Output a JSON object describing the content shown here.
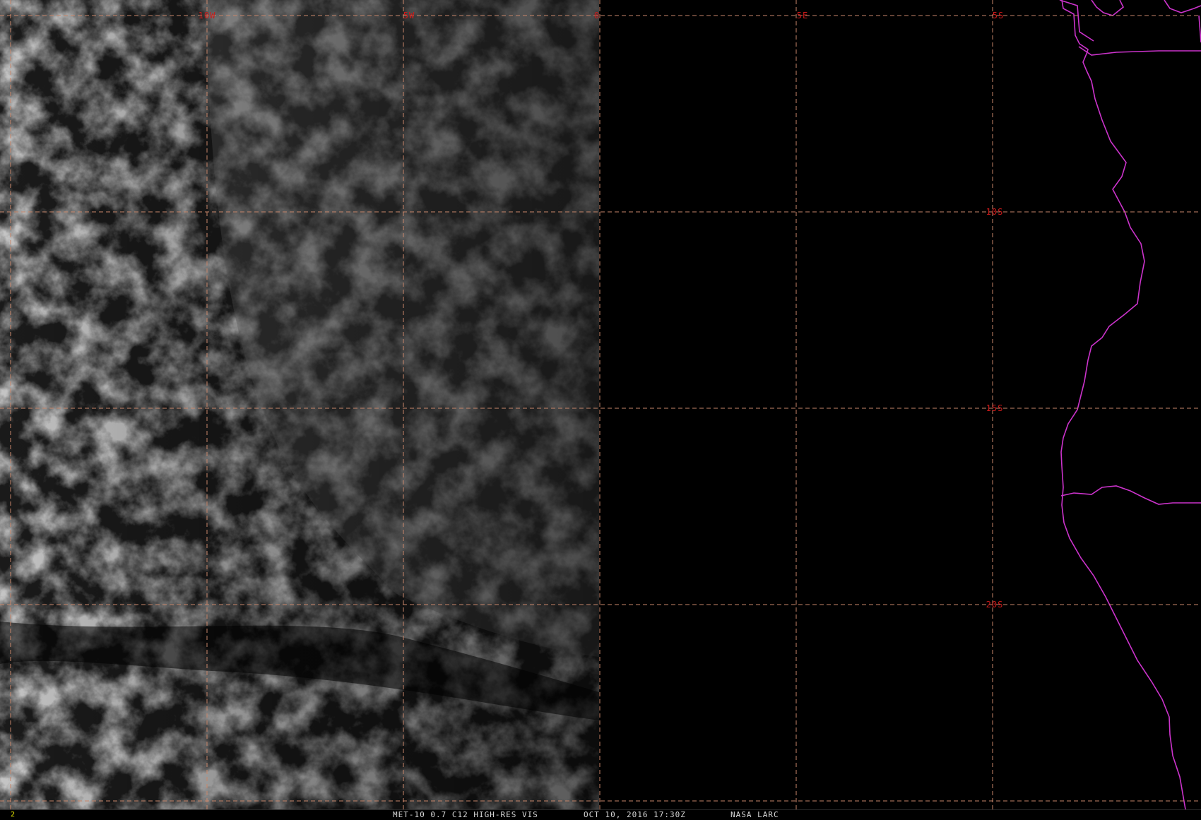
{
  "map": {
    "graticule": {
      "longitude_labels": [
        "10W",
        "5W",
        "0",
        "5E"
      ],
      "latitude_labels": [
        "5S",
        "10S",
        "15S",
        "20S"
      ]
    },
    "colors": {
      "grid_line": "#c8866a",
      "grid_label": "#cc1a1a",
      "political_boundaries": "#cc33cc",
      "background": "#000000"
    },
    "imagery_note_visible": "Cloud field over ocean west of 0 longitude; dark east of terminator"
  },
  "status_bar": {
    "frame_number": "2",
    "product": "MET-10 0.7 C12 HIGH-RES VIS",
    "datetime": "OCT 10, 2016 17:30Z",
    "source": "NASA LARC"
  }
}
